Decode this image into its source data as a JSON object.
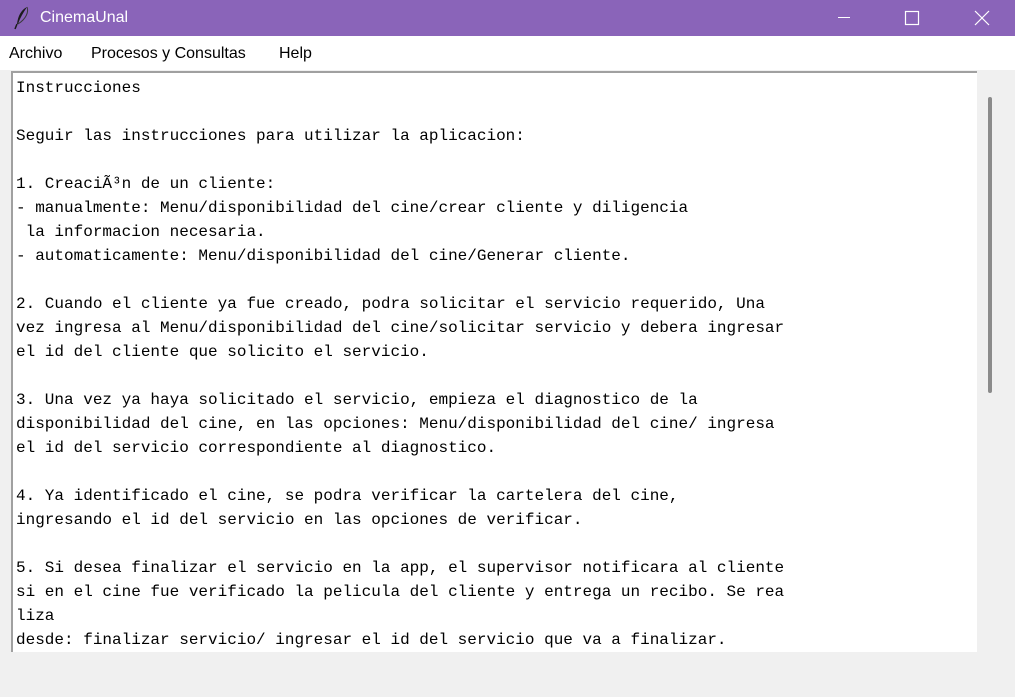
{
  "window": {
    "title": "CinemaUnal",
    "colors": {
      "titlebar": "#8a64b9",
      "background": "#f0f0f0",
      "text_area": "#ffffff"
    },
    "icons": [
      "feather-icon",
      "minimize-icon",
      "maximize-icon",
      "close-icon"
    ]
  },
  "menubar": {
    "items": [
      "Archivo",
      "Procesos y Consultas",
      "Help"
    ]
  },
  "instructions": {
    "lines": [
      "Instrucciones",
      "",
      "Seguir las instrucciones para utilizar la aplicacion:",
      "",
      "1. CreaciÃ³n de un cliente:",
      "- manualmente: Menu/disponibilidad del cine/crear cliente y diligencia",
      " la informacion necesaria.",
      "- automaticamente: Menu/disponibilidad del cine/Generar cliente.",
      "",
      "2. Cuando el cliente ya fue creado, podra solicitar el servicio requerido, Una",
      "vez ingresa al Menu/disponibilidad del cine/solicitar servicio y debera ingresar",
      "el id del cliente que solicito el servicio.",
      "",
      "3. Una vez ya haya solicitado el servicio, empieza el diagnostico de la",
      "disponibilidad del cine, en las opciones: Menu/disponibilidad del cine/ ingresa",
      "el id del servicio correspondiente al diagnostico.",
      "",
      "4. Ya identificado el cine, se podra verificar la cartelera del cine,",
      "ingresando el id del servicio en las opciones de verificar.",
      "",
      "5. Si desea finalizar el servicio en la app, el supervisor notificara al cliente",
      "si en el cine fue verificado la pelicula del cliente y entrega un recibo. Se rea",
      "liza",
      "desde: finalizar servicio/ ingresar el id del servicio que va a finalizar."
    ]
  }
}
